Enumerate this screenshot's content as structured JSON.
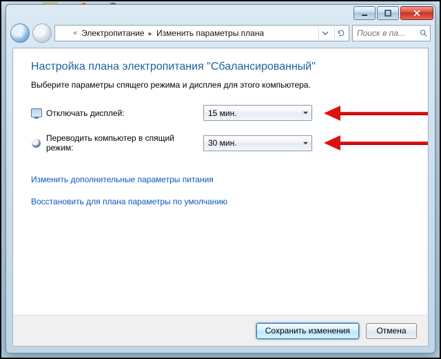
{
  "breadcrumb": {
    "parent": "Электропитание",
    "current": "Изменить параметры плана"
  },
  "search": {
    "placeholder": "Поиск в па..."
  },
  "page": {
    "title": "Настройка плана электропитания \"Сбалансированный\"",
    "subtitle": "Выберите параметры спящего режима и дисплея для этого компьютера."
  },
  "settings": {
    "display_off": {
      "label": "Отключать дисплей:",
      "value": "15 мин."
    },
    "sleep": {
      "label": "Переводить компьютер в спящий режим:",
      "value": "30 мин."
    }
  },
  "links": {
    "advanced": "Изменить дополнительные параметры питания",
    "restore_defaults": "Восстановить для плана параметры по умолчанию"
  },
  "buttons": {
    "save": "Сохранить изменения",
    "cancel": "Отмена"
  }
}
